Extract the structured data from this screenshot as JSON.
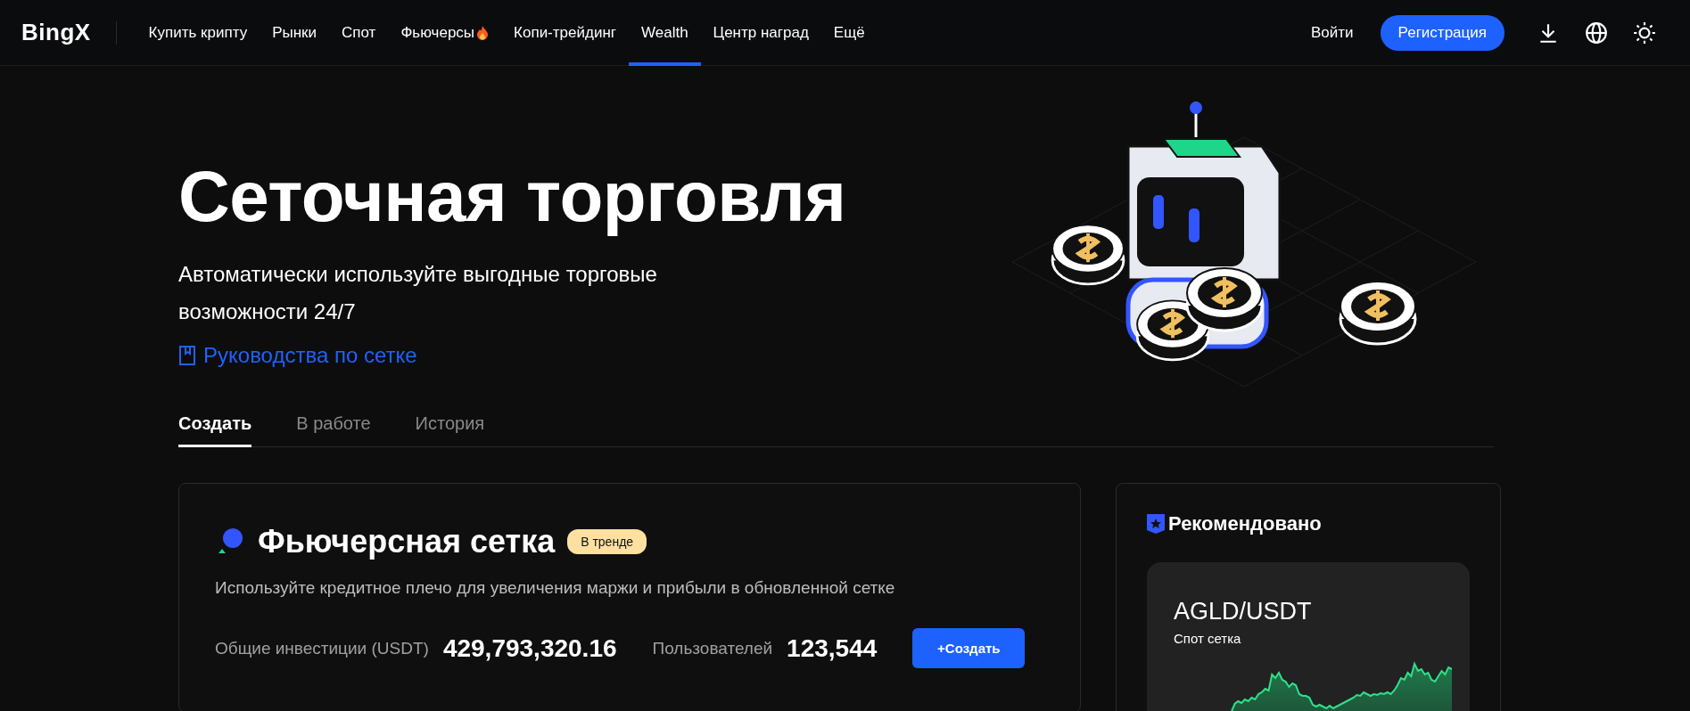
{
  "nav": {
    "logo": "BingX",
    "items": [
      {
        "label": "Купить крипту",
        "selected": false,
        "hot": false
      },
      {
        "label": "Рынки",
        "selected": false,
        "hot": false
      },
      {
        "label": "Спот",
        "selected": false,
        "hot": false
      },
      {
        "label": "Фьючерсы",
        "selected": false,
        "hot": true
      },
      {
        "label": "Копи-трейдинг",
        "selected": false,
        "hot": false
      },
      {
        "label": "Wealth",
        "selected": true,
        "hot": false
      },
      {
        "label": "Центр наград",
        "selected": false,
        "hot": false
      },
      {
        "label": "Ещё",
        "selected": false,
        "hot": false
      }
    ],
    "login": "Войти",
    "register": "Регистрация"
  },
  "hero": {
    "title": "Сеточная торговля",
    "subtitle": "Автоматически используйте выгодные торговые возможности 24/7",
    "guide_link": "Руководства по сетке"
  },
  "tabs": [
    {
      "label": "Создать",
      "selected": true
    },
    {
      "label": "В работе",
      "selected": false
    },
    {
      "label": "История",
      "selected": false
    }
  ],
  "grid_card": {
    "title": "Фьючерсная сетка",
    "badge": "В тренде",
    "description": "Используйте кредитное плечо для увеличения маржи и прибыли в обновленной сетке",
    "investment_label": "Общие инвестиции (USDT)",
    "investment_value": "429,793,320.16",
    "users_label": "Пользователей",
    "users_value": "123,544",
    "create_button": "+Создать"
  },
  "recommended": {
    "title": "Рекомендовано",
    "pair": "AGLD/USDT",
    "type": "Спот сетка"
  }
}
